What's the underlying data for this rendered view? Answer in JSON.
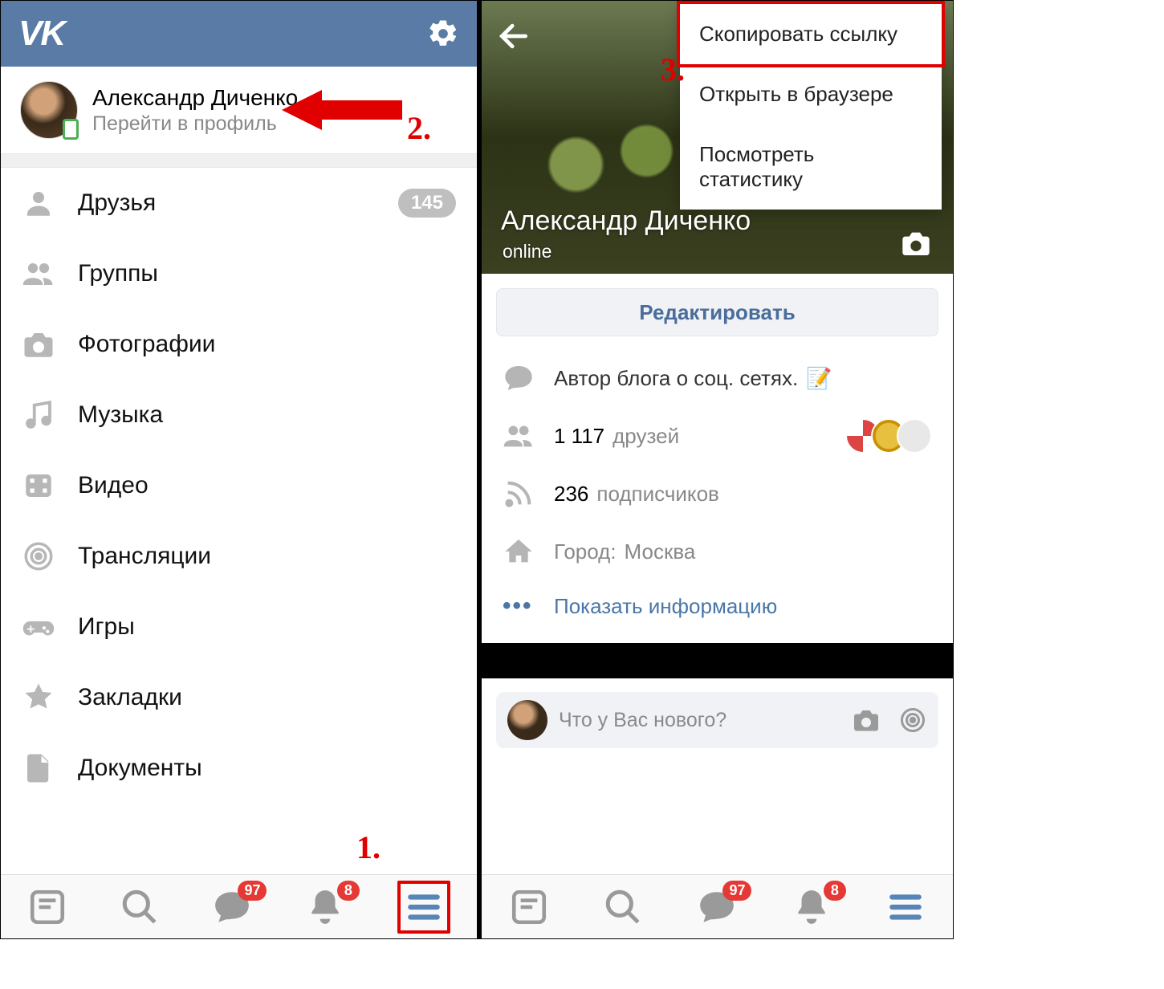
{
  "left": {
    "profile": {
      "name": "Александр Диченко",
      "sub": "Перейти в профиль"
    },
    "menu": {
      "friends": {
        "label": "Друзья",
        "count": "145"
      },
      "groups": {
        "label": "Группы"
      },
      "photos": {
        "label": "Фотографии"
      },
      "music": {
        "label": "Музыка"
      },
      "videos": {
        "label": "Видео"
      },
      "live": {
        "label": "Трансляции"
      },
      "games": {
        "label": "Игры"
      },
      "bookmarks": {
        "label": "Закладки"
      },
      "docs": {
        "label": "Документы"
      }
    },
    "nav_badges": {
      "messages": "97",
      "notifications": "8"
    }
  },
  "right": {
    "dropdown": {
      "copy": "Скопировать ссылку",
      "open": "Открыть в браузере",
      "stats": "Посмотреть статистику"
    },
    "cover": {
      "name": "Александр Диченко",
      "status": "online"
    },
    "edit_label": "Редактировать",
    "info": {
      "bio": "Автор блога о соц. сетях.",
      "friends_count": "1 117",
      "friends_label": "друзей",
      "subs_count": "236",
      "subs_label": "подписчиков",
      "city_label": "Город:",
      "city_value": "Москва"
    },
    "more_label": "Показать информацию",
    "composer_placeholder": "Что у Вас нового?",
    "nav_badges": {
      "messages": "97",
      "notifications": "8"
    }
  },
  "annotations": {
    "a1": "1.",
    "a2": "2.",
    "a3": "3."
  }
}
